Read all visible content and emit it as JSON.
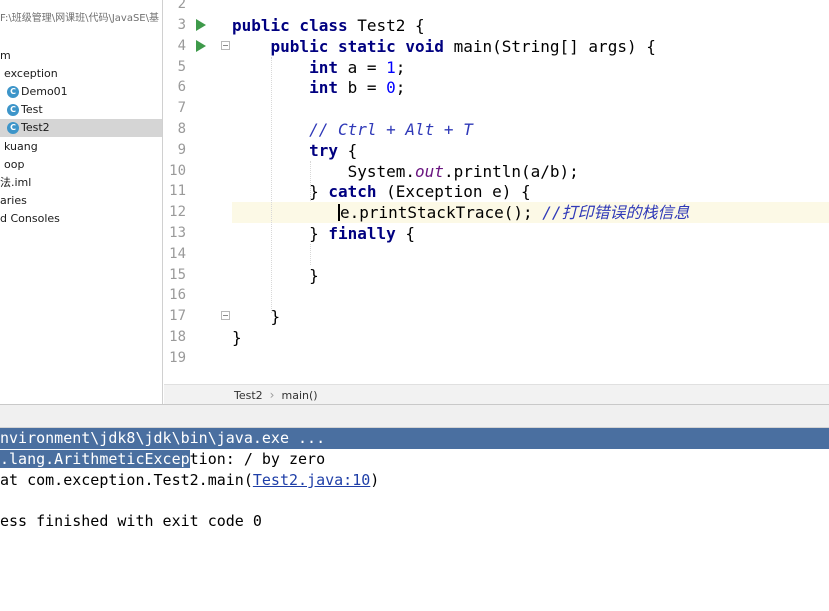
{
  "sidebar": {
    "path": "F:\\班级管理\\网课班\\代码\\JavaSE\\基",
    "items": [
      {
        "label": "m",
        "icon": ""
      },
      {
        "label": "exception",
        "icon": ""
      },
      {
        "label": "Demo01",
        "icon": "class-icon"
      },
      {
        "label": "Test",
        "icon": "class-icon"
      },
      {
        "label": "Test2",
        "icon": "class-icon"
      },
      {
        "label": "kuang",
        "icon": ""
      },
      {
        "label": "oop",
        "icon": ""
      },
      {
        "label": "法.iml",
        "icon": ""
      },
      {
        "label": "aries",
        "icon": ""
      },
      {
        "label": "d Consoles",
        "icon": ""
      }
    ],
    "selected": "Test2"
  },
  "editor": {
    "line_numbers": [
      "2",
      "3",
      "4",
      "5",
      "6",
      "7",
      "8",
      "9",
      "10",
      "11",
      "12",
      "13",
      "14",
      "15",
      "16",
      "17",
      "18",
      "19"
    ],
    "code": {
      "l3_kw": "public class ",
      "l3_rest": "Test2 {",
      "l4_kw": "public static void ",
      "l4_rest": "main(String[] args) {",
      "int": "int",
      "l5_rest": " a = ",
      "l5_num": "1",
      "semicolon": ";",
      "l6_rest": " b = ",
      "l6_num": "0",
      "l8_comment": "// Ctrl + Alt + T",
      "try": "try",
      "l9_rest": " {",
      "l10_a": "System.",
      "l10_field": "out",
      "l10_b": ".println(a/b);",
      "l11_a": "} ",
      "catch": "catch",
      "l11_b": " (Exception e) {",
      "l12_e": "e",
      "l12_rest": ".printStackTrace(); ",
      "l12_comment": "//打印错误的栈信息",
      "l13_a": "} ",
      "finally": "finally",
      "l13_b": " {",
      "close_brace": "}"
    }
  },
  "breadcrumb": {
    "items": [
      "Test2",
      "main()"
    ]
  },
  "console": {
    "line1": "nvironment\\jdk8\\jdk\\bin\\java.exe ...",
    "line2_sel": ".lang.ArithmeticExcep",
    "line2_rest": "tion: / by zero",
    "line3_pre": "at com.exception.Test2.main(",
    "line3_link": "Test2.java:10",
    "line3_post": ")",
    "line5": "ess finished with exit code 0"
  },
  "colors": {
    "keyword": "#000080",
    "comment": "#2f39b8",
    "number": "#0000ff",
    "run_icon": "#3e9a4a",
    "console_selection": "#4a6fa0",
    "current_line": "#fcf9e6"
  }
}
